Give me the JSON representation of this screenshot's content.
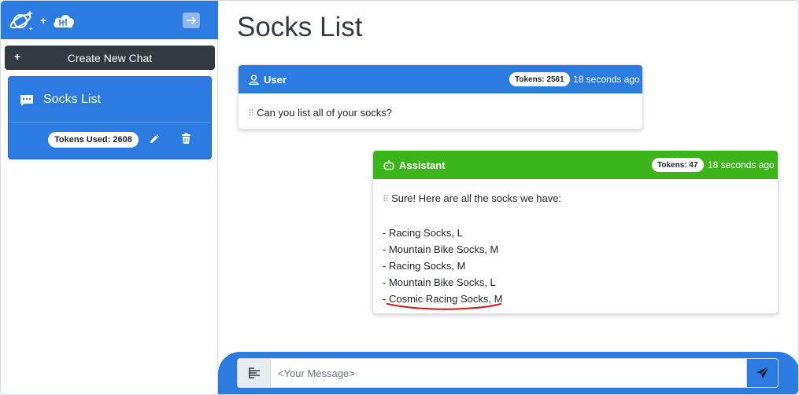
{
  "sidebar": {
    "logo_icons": [
      "planet-sparkle-icon",
      "cloud-brain-icon"
    ],
    "collapse_icon": "arrow-right-icon",
    "create_chat": {
      "label": "Create New Chat",
      "icon": "plus-icon"
    },
    "chats": [
      {
        "title": "Socks List",
        "icon": "chat-bubble-icon",
        "tokens_label": "Tokens Used: 2608",
        "actions": [
          "pencil-icon",
          "trash-icon"
        ]
      }
    ]
  },
  "main": {
    "title": "Socks List",
    "messages": [
      {
        "role": "User",
        "role_icon": "user-icon",
        "tokens": "Tokens: 2561",
        "time": "18 seconds ago",
        "lines": [
          "Can you list all of your socks?"
        ]
      },
      {
        "role": "Assistant",
        "role_icon": "robot-icon",
        "tokens": "Tokens: 47",
        "time": "18 seconds ago",
        "lines": [
          "Sure! Here are all the socks we have:",
          "",
          "- Racing Socks, L",
          "- Mountain Bike Socks, M",
          "- Racing Socks, M",
          "- Mountain Bike Socks, L"
        ],
        "last_line_prefix": "- ",
        "last_line_highlight": "Cosmic Racing Socks, M"
      }
    ]
  },
  "composer": {
    "placeholder": "<Your Message>",
    "value": "",
    "format_icon": "format-align-icon",
    "send_icon": "send-icon"
  },
  "colors": {
    "primary": "#2b7be0",
    "assistant": "#3cb51a",
    "dark_button": "#343a40",
    "annotation": "#d9141b"
  }
}
